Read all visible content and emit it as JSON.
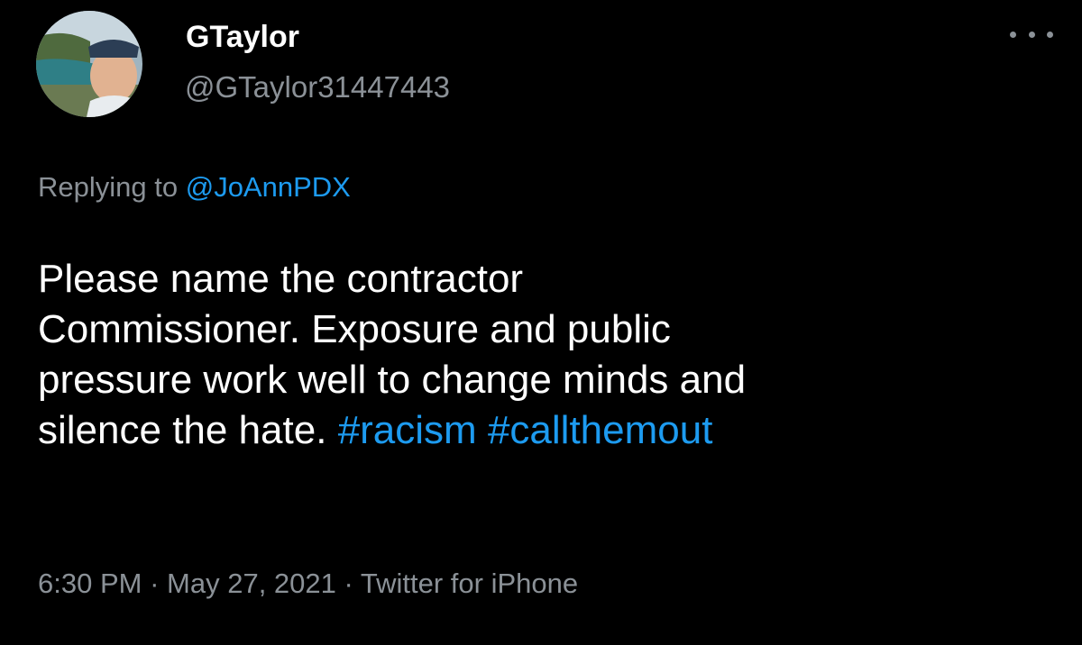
{
  "user": {
    "display_name": "GTaylor",
    "handle": "@GTaylor31447443",
    "avatar_icon": "profile-photo"
  },
  "more_icon": "ellipsis-icon",
  "reply": {
    "prefix": "Replying to",
    "mention": "@JoAnnPDX"
  },
  "tweet": {
    "lines": [
      "Please name the contractor",
      "Commissioner. Exposure and public",
      "pressure work well to change minds and",
      "silence the hate."
    ],
    "hashtags": [
      "#racism",
      "#callthemout"
    ]
  },
  "meta": {
    "time": "6:30 PM",
    "separator": "·",
    "date": "May 27, 2021",
    "source": "Twitter for iPhone"
  },
  "colors": {
    "background": "#000000",
    "text": "#ffffff",
    "secondary": "#8b9197",
    "link": "#1d9bf0"
  }
}
